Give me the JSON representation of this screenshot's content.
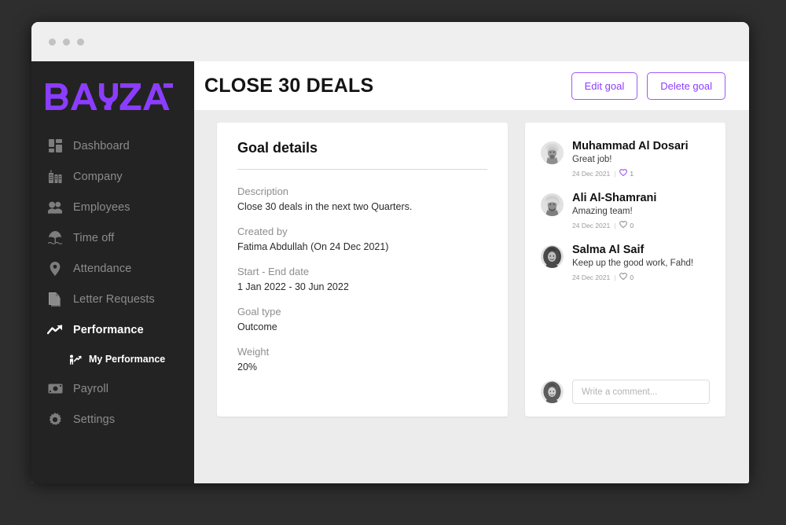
{
  "window": {
    "traffic_dots": [
      "dot-1",
      "dot-2",
      "dot-3"
    ]
  },
  "sidebar": {
    "logo_text": "BAYZAT",
    "brand_color": "#8B3DFF",
    "items": [
      {
        "label": "Dashboard",
        "icon": "dashboard-grid-icon",
        "active": false
      },
      {
        "label": "Company",
        "icon": "buildings-icon",
        "active": false
      },
      {
        "label": "Employees",
        "icon": "people-icon",
        "active": false
      },
      {
        "label": "Time off",
        "icon": "beach-umbrella-icon",
        "active": false
      },
      {
        "label": "Attendance",
        "icon": "map-pin-icon",
        "active": false
      },
      {
        "label": "Letter Requests",
        "icon": "document-icon",
        "active": false
      },
      {
        "label": "Performance",
        "icon": "trend-up-arrow-icon",
        "active": true
      },
      {
        "label": "Payroll",
        "icon": "money-bill-icon",
        "active": false
      },
      {
        "label": "Settings",
        "icon": "gear-icon",
        "active": false
      }
    ],
    "sub_item": {
      "label": "My Performance",
      "icon": "person-growth-icon"
    }
  },
  "header": {
    "title": "CLOSE 30 DEALS",
    "edit_label": "Edit goal",
    "delete_label": "Delete goal"
  },
  "goal_card": {
    "title": "Goal details",
    "fields": [
      {
        "label": "Description",
        "value": "Close 30 deals in the next two Quarters."
      },
      {
        "label": "Created by",
        "value": "Fatima Abdullah (On 24 Dec 2021)"
      },
      {
        "label": "Start - End date",
        "value": "1 Jan 2022 - 30 Jun 2022"
      },
      {
        "label": "Goal type",
        "value": "Outcome"
      },
      {
        "label": "Weight",
        "value": "20%"
      }
    ]
  },
  "comments": {
    "items": [
      {
        "author": "Muhammad Al Dosari",
        "text": "Great job!",
        "date": "24 Dec 2021",
        "likes": "1",
        "liked": true,
        "avatar": "avatar-muhammad"
      },
      {
        "author": "Ali Al-Shamrani",
        "text": "Amazing team!",
        "date": "24 Dec 2021",
        "likes": "0",
        "liked": false,
        "avatar": "avatar-ali"
      },
      {
        "author": "Salma Al Saif",
        "text": "Keep up the good work, Fahd!",
        "date": "24 Dec 2021",
        "likes": "0",
        "liked": false,
        "avatar": "avatar-salma"
      }
    ],
    "separator": "|",
    "composer": {
      "placeholder": "Write a comment...",
      "value": "",
      "avatar": "avatar-current-user"
    }
  }
}
